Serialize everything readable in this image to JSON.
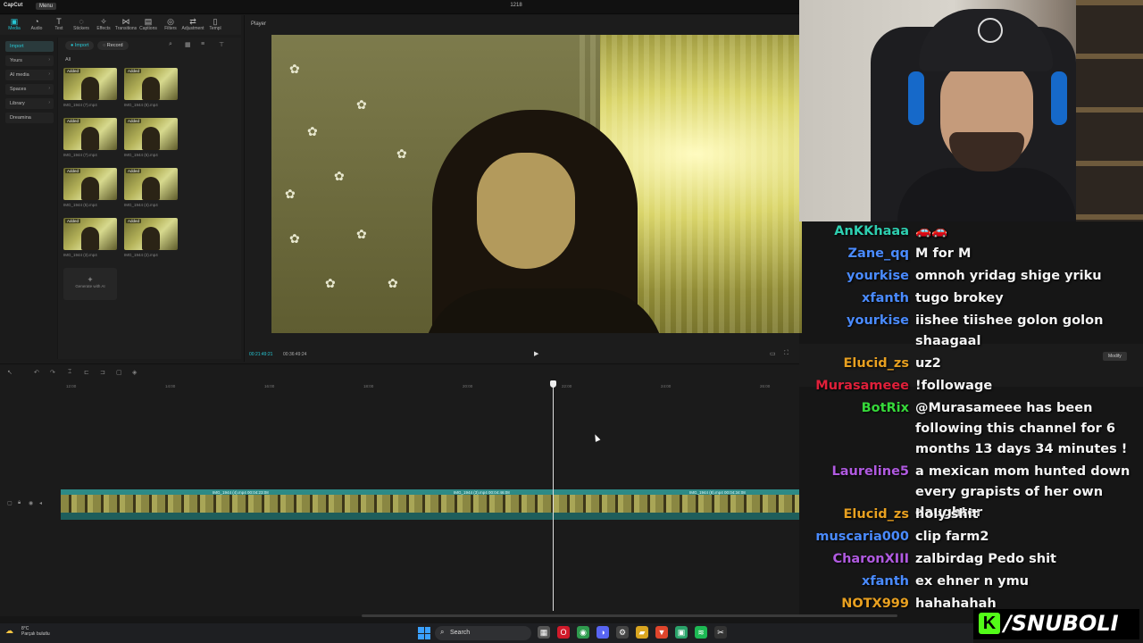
{
  "app": {
    "logo": "CapCut",
    "menu": "Menu",
    "project_title": "1218"
  },
  "toolbar": [
    {
      "icon": "media-icon",
      "glyph": "▣",
      "label": "Media",
      "active": true
    },
    {
      "icon": "audio-icon",
      "glyph": "◔",
      "label": "Audio"
    },
    {
      "icon": "text-icon",
      "glyph": "T",
      "label": "Text"
    },
    {
      "icon": "stickers-icon",
      "glyph": "◌",
      "label": "Stickers"
    },
    {
      "icon": "effects-icon",
      "glyph": "✧",
      "label": "Effects"
    },
    {
      "icon": "transitions-icon",
      "glyph": "⋈",
      "label": "Transitions"
    },
    {
      "icon": "captions-icon",
      "glyph": "▤",
      "label": "Captions"
    },
    {
      "icon": "filters-icon",
      "glyph": "◎",
      "label": "Filters"
    },
    {
      "icon": "adjustment-icon",
      "glyph": "⇄",
      "label": "Adjustment"
    },
    {
      "icon": "templates-icon",
      "glyph": "▯",
      "label": "Templ"
    }
  ],
  "leftnav": [
    {
      "label": "Import",
      "active": true
    },
    {
      "label": "Yours",
      "chev": "›"
    },
    {
      "label": "AI media",
      "chev": "›"
    },
    {
      "label": "Spaces",
      "chev": "›"
    },
    {
      "label": "Library",
      "chev": "›"
    },
    {
      "label": "Dreamina"
    }
  ],
  "media": {
    "import_label": "Import",
    "record_label": "Record",
    "filter_label": "All",
    "generate_label": "Generate with AI",
    "items": [
      {
        "badge": "Added",
        "name": "IMG_1944 (7).mp4"
      },
      {
        "badge": "Added",
        "name": "IMG_1944 (8).mp4"
      },
      {
        "badge": "Added",
        "name": "IMG_1944 (7).mp4"
      },
      {
        "badge": "Added",
        "name": "IMG_1944 (6).mp4"
      },
      {
        "badge": "Added",
        "name": "IMG_1944 (5).mp4"
      },
      {
        "badge": "Added",
        "name": "IMG_1944 (4).mp4"
      },
      {
        "badge": "Added",
        "name": "IMG_1944 (3).mp4"
      },
      {
        "badge": "Added",
        "name": "IMG_1944 (2).mp4"
      }
    ]
  },
  "player": {
    "label": "Player",
    "current_time": "00:21:49:21",
    "total_time": "00:36:49:24",
    "play_glyph": "▶"
  },
  "timeline": {
    "ticks": [
      "12:00",
      "14:00",
      "16:00",
      "18:00",
      "20:00",
      "22:00",
      "24:00",
      "26:00"
    ],
    "clips": [
      {
        "name": "IMG_1944 (4).mp4  00:04:23:08"
      },
      {
        "name": "IMG_1944 (3).mp4  00:04:46:08"
      },
      {
        "name": "IMG_1944 (8).mp4  00:04:34:08"
      }
    ],
    "modify_label": "Modify"
  },
  "chat": [
    {
      "user": "AnKKhaaa",
      "color": "#2ecfb0",
      "text": "🚗🚗"
    },
    {
      "user": "Zane_qq",
      "color": "#4a8bff",
      "text": "M for M"
    },
    {
      "user": "yourkise",
      "color": "#4a8bff",
      "text": "omnoh yridag shige yriku"
    },
    {
      "user": "xfanth",
      "color": "#4a8bff",
      "text": "tugo brokey"
    },
    {
      "user": "yourkise",
      "color": "#4a8bff",
      "text": "iishee tiishee golon golon shaagaal"
    },
    {
      "user": "Elucid_zs",
      "color": "#e8a020",
      "text": "uz2"
    },
    {
      "user": "Murasameee",
      "color": "#e0203a",
      "text": "!followage"
    },
    {
      "user": "BotRix",
      "color": "#36d83a",
      "text": "@Murasameee has been following this channel for 6 months 13 days 34 minutes !"
    },
    {
      "user": "Laureline5",
      "color": "#b05ae0",
      "text": "a mexican mom hunted down every grapists of her own daughter"
    },
    {
      "user": "Elucid_zs",
      "color": "#e8a020",
      "text": "holy shit"
    },
    {
      "user": "muscaria000",
      "color": "#4a8bff",
      "text": "clip farm2"
    },
    {
      "user": "CharonXIII",
      "color": "#b05ae0",
      "text": "zalbirdag Pedo shit"
    },
    {
      "user": "xfanth",
      "color": "#4a8bff",
      "text": "ex ehner n ymu"
    },
    {
      "user": "NOTX999",
      "color": "#e8a020",
      "text": "hahahahah"
    }
  ],
  "brand": {
    "icon": "K",
    "name": "/SNUBOLI"
  },
  "taskbar": {
    "temp": "8°C",
    "weather": "Parçalı bulutlu",
    "search": "Search",
    "icons": [
      {
        "name": "task-view-icon",
        "glyph": "▦",
        "color": "#555"
      },
      {
        "name": "opera-icon",
        "glyph": "O",
        "color": "#d01a2a"
      },
      {
        "name": "chrome-icon",
        "glyph": "◉",
        "color": "#2f9b4e"
      },
      {
        "name": "discord-icon",
        "glyph": "◑",
        "color": "#5865f2"
      },
      {
        "name": "settings-icon",
        "glyph": "⚙",
        "color": "#444"
      },
      {
        "name": "explorer-icon",
        "glyph": "▰",
        "color": "#d9a520"
      },
      {
        "name": "brave-icon",
        "glyph": "▼",
        "color": "#e0452c"
      },
      {
        "name": "xbox-icon",
        "glyph": "▣",
        "color": "#2aa36a"
      },
      {
        "name": "spotify-icon",
        "glyph": "≋",
        "color": "#1db954"
      },
      {
        "name": "capcut-icon",
        "glyph": "✂",
        "color": "#333"
      }
    ]
  }
}
